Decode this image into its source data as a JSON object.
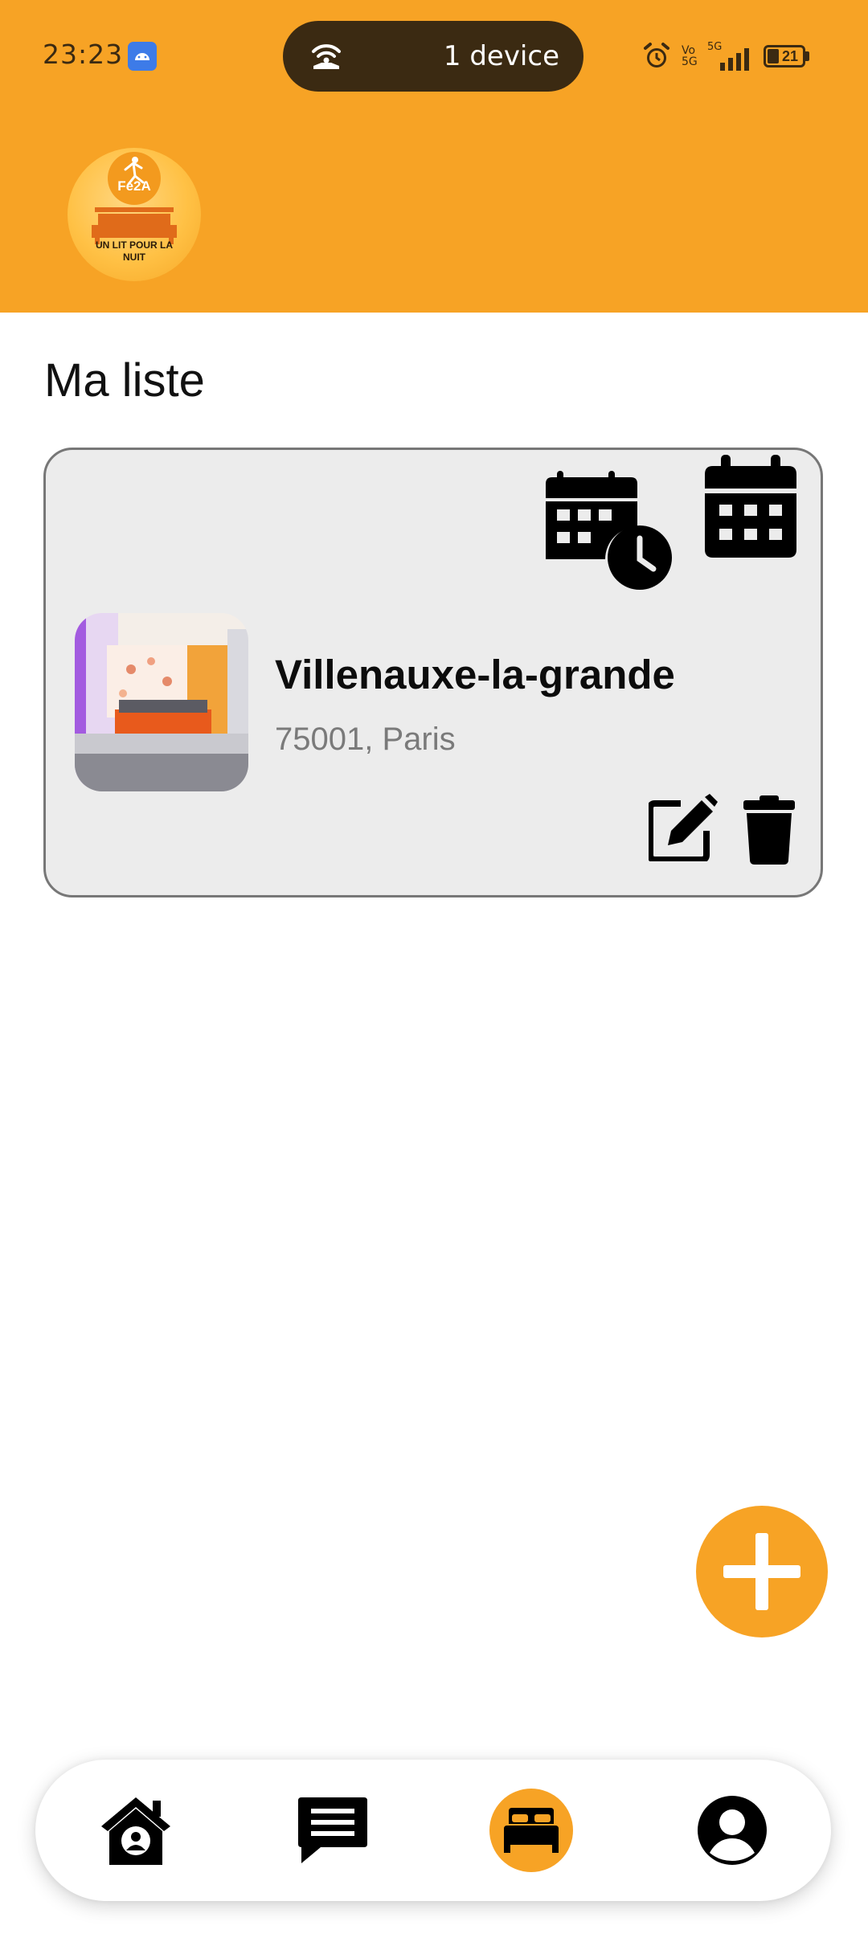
{
  "status_bar": {
    "time": "23:23",
    "hotspot": {
      "icon": "hotspot-icon",
      "label": "1 device"
    },
    "network_labels": [
      "Vo 5G",
      "5G"
    ],
    "battery_level": "21"
  },
  "header": {
    "logo": {
      "brand_text": "Fe2A",
      "slogan": "UN LIT POUR LA NUIT"
    }
  },
  "page": {
    "title": "Ma liste"
  },
  "listings": [
    {
      "title": "Villenauxe-la-grande",
      "address": "75001, Paris",
      "actions": [
        "calendar-clock-icon",
        "calendar-icon",
        "edit-icon",
        "trash-icon"
      ]
    }
  ],
  "fab": {
    "icon": "plus-icon"
  },
  "bottom_nav": {
    "items": [
      {
        "icon": "home-user-icon",
        "active": false
      },
      {
        "icon": "chat-icon",
        "active": false
      },
      {
        "icon": "bed-icon",
        "active": true
      },
      {
        "icon": "profile-icon",
        "active": false
      }
    ]
  },
  "colors": {
    "accent": "#F7A325",
    "card_bg": "#ECECEC",
    "address": "#7A7A7A"
  }
}
